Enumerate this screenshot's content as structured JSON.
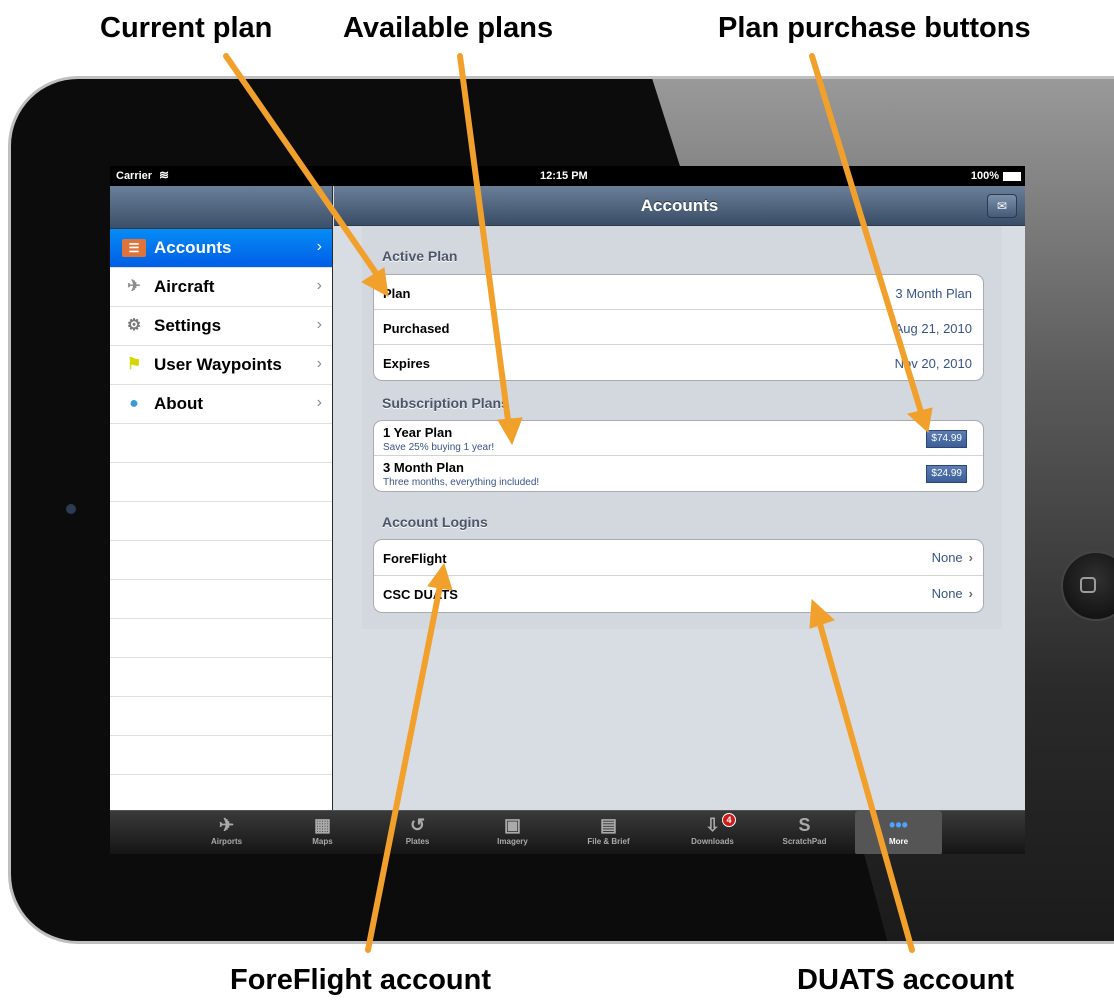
{
  "annotations": {
    "current_plan": "Current plan",
    "available_plans": "Available plans",
    "purchase_buttons": "Plan purchase buttons",
    "foreflight_account": "ForeFlight account",
    "duats_account": "DUATS account"
  },
  "status_bar": {
    "carrier": "Carrier",
    "wifi_icon": "wifi-icon",
    "time": "12:15 PM",
    "battery": "100%"
  },
  "sidebar": {
    "items": [
      {
        "label": "Accounts",
        "icon": "id-card-icon",
        "selected": true
      },
      {
        "label": "Aircraft",
        "icon": "airplane-icon",
        "selected": false
      },
      {
        "label": "Settings",
        "icon": "gear-icon",
        "selected": false
      },
      {
        "label": "User Waypoints",
        "icon": "flag-icon",
        "selected": false
      },
      {
        "label": "About",
        "icon": "info-icon",
        "selected": false
      }
    ]
  },
  "detail": {
    "title": "Accounts",
    "mail_button_icon": "envelope-icon",
    "active_plan": {
      "header": "Active Plan",
      "rows": [
        {
          "label": "Plan",
          "value": "3 Month Plan"
        },
        {
          "label": "Purchased",
          "value": "Aug 21, 2010"
        },
        {
          "label": "Expires",
          "value": "Nov 20, 2010"
        }
      ]
    },
    "subscription_plans": {
      "header": "Subscription Plans",
      "plans": [
        {
          "name": "1 Year Plan",
          "description": "Save 25% buying 1 year!",
          "price": "$74.99"
        },
        {
          "name": "3 Month Plan",
          "description": "Three months, everything included!",
          "price": "$24.99"
        }
      ]
    },
    "account_logins": {
      "header": "Account Logins",
      "rows": [
        {
          "label": "ForeFlight",
          "value": "None"
        },
        {
          "label": "CSC DUATS",
          "value": "None"
        }
      ]
    }
  },
  "tabbar": {
    "tabs": [
      {
        "label": "Airports",
        "icon": "airport-icon"
      },
      {
        "label": "Maps",
        "icon": "map-icon"
      },
      {
        "label": "Plates",
        "icon": "plates-icon"
      },
      {
        "label": "Imagery",
        "icon": "imagery-icon"
      },
      {
        "label": "File & Brief",
        "icon": "file-brief-icon"
      },
      {
        "label": "Downloads",
        "icon": "download-icon",
        "badge": "4"
      },
      {
        "label": "ScratchPad",
        "icon": "scratchpad-icon"
      },
      {
        "label": "More",
        "icon": "more-icon",
        "selected": true
      }
    ]
  },
  "colors": {
    "arrow": "#f2a02c",
    "selection_blue": "#0a74e8",
    "nav_bar": "#4e6380"
  }
}
